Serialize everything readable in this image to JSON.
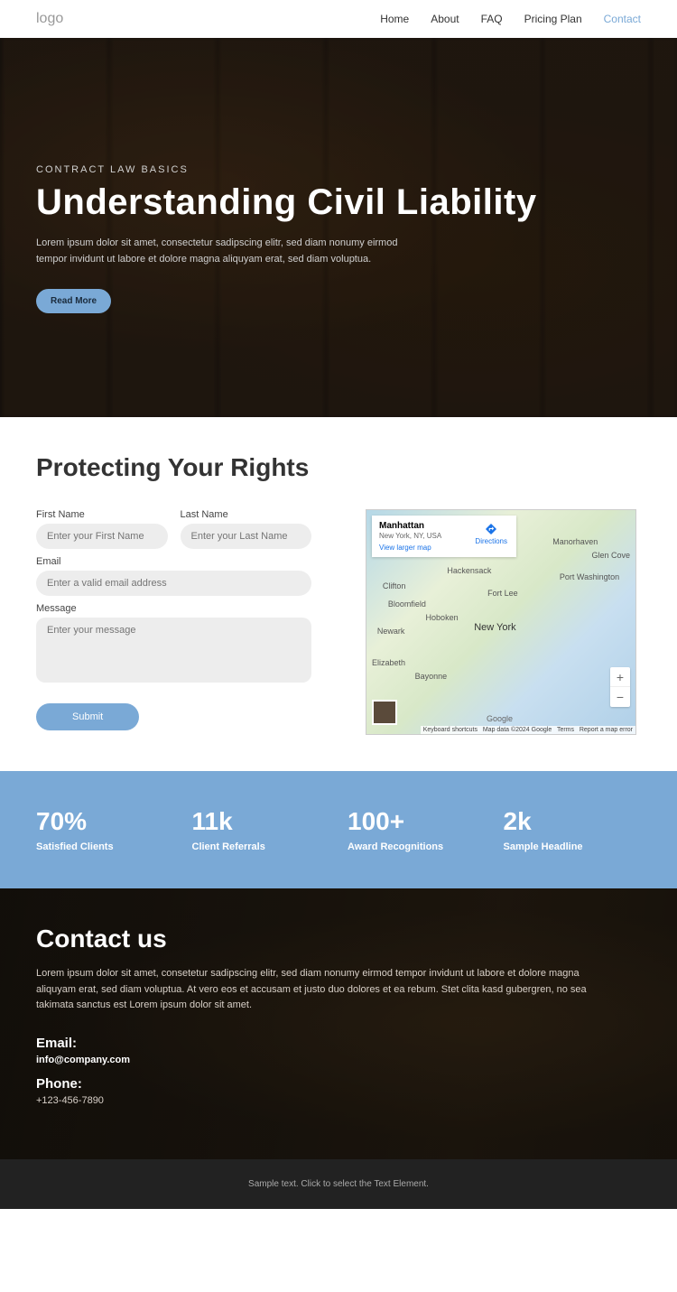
{
  "header": {
    "logo": "logo",
    "nav": {
      "home": "Home",
      "about": "About",
      "faq": "FAQ",
      "pricing": "Pricing Plan",
      "contact": "Contact"
    }
  },
  "hero": {
    "eyebrow": "CONTRACT LAW BASICS",
    "title": "Understanding Civil Liability",
    "body": "Lorem ipsum dolor sit amet, consectetur sadipscing elitr, sed diam nonumy eirmod tempor invidunt ut labore et dolore magna aliquyam erat, sed diam voluptua.",
    "cta": "Read More"
  },
  "section2": {
    "title": "Protecting Your Rights"
  },
  "form": {
    "firstNameLabel": "First Name",
    "firstNamePh": "Enter your First Name",
    "lastNameLabel": "Last Name",
    "lastNamePh": "Enter your Last Name",
    "emailLabel": "Email",
    "emailPh": "Enter a valid email address",
    "msgLabel": "Message",
    "msgPh": "Enter your message",
    "submit": "Submit"
  },
  "map": {
    "infoTitle": "Manhattan",
    "infoSub": "New York, NY, USA",
    "largerLink": "View larger map",
    "directions": "Directions",
    "cityLabel": "New York",
    "zoomIn": "+",
    "zoomOut": "−",
    "attPre": "Keyboard shortcuts",
    "attMid": "Map data ©2024 Google",
    "attTerms": "Terms",
    "attReport": "Report a map error",
    "google": "Google",
    "labels": {
      "manorhaven": "Manorhaven",
      "hackensack": "Hackensack",
      "clifton": "Clifton",
      "hoboken": "Hoboken",
      "newark": "Newark",
      "elizabeth": "Elizabeth",
      "bayonne": "Bayonne",
      "portwash": "Port Washington",
      "glencove": "Glen Cove",
      "fortlee": "Fort Lee",
      "bloomfield": "Bloomfield"
    }
  },
  "stats": [
    {
      "num": "70%",
      "label": "Satisfied Clients"
    },
    {
      "num": "11k",
      "label": "Client Referrals"
    },
    {
      "num": "100+",
      "label": "Award Recognitions"
    },
    {
      "num": "2k",
      "label": "Sample Headline"
    }
  ],
  "contact": {
    "title": "Contact us",
    "body": "Lorem ipsum dolor sit amet, consetetur sadipscing elitr, sed diam nonumy eirmod tempor invidunt ut labore et dolore magna aliquyam erat, sed diam voluptua. At vero eos et accusam et justo duo dolores et ea rebum. Stet clita kasd gubergren, no sea takimata sanctus est Lorem ipsum dolor sit amet.",
    "emailLabel": "Email:",
    "emailVal": "info@company.com",
    "phoneLabel": "Phone:",
    "phoneVal": "+123-456-7890"
  },
  "footer": {
    "text": "Sample text. Click to select the Text Element."
  }
}
